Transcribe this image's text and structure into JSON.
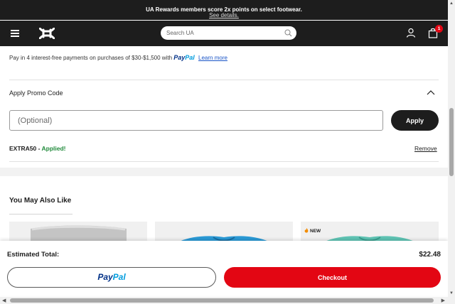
{
  "promo_banner": {
    "message": "UA Rewards members score 2x points on select footwear.",
    "link_text": "See details."
  },
  "header": {
    "logo": "under-armour-logo",
    "search": {
      "placeholder": "Search UA",
      "value": ""
    },
    "bag_count": "1",
    "icons": [
      "menu-icon",
      "search-icon",
      "account-icon",
      "bag-icon"
    ]
  },
  "payment_note": {
    "text": "Pay in 4 interest-free payments on purchases of $30-$1,500 with",
    "paypal_pay": "Pay",
    "paypal_pal": "Pal",
    "learn_more": "Learn more"
  },
  "promo_code": {
    "title": "Apply Promo Code",
    "input_placeholder": "(Optional)",
    "input_value": "",
    "apply_label": "Apply",
    "applied_code": "EXTRA50",
    "applied_separator": " - ",
    "applied_status": "Applied!",
    "remove_label": "Remove"
  },
  "recommendations": {
    "title": "You May Also Like",
    "products": [
      {
        "badge": ""
      },
      {
        "badge": ""
      },
      {
        "badge": "NEW"
      }
    ]
  },
  "footer": {
    "total_label": "Estimated Total:",
    "total_value": "$22.48",
    "paypal_pay": "Pay",
    "paypal_pal": "Pal",
    "checkout_label": "Checkout"
  },
  "colors": {
    "header_bg": "#1d1d1d",
    "checkout_red": "#e30613",
    "applied_green": "#1f8a3a",
    "link_blue": "#1a55c7",
    "paypal_dark": "#003087",
    "paypal_light": "#009cde"
  }
}
